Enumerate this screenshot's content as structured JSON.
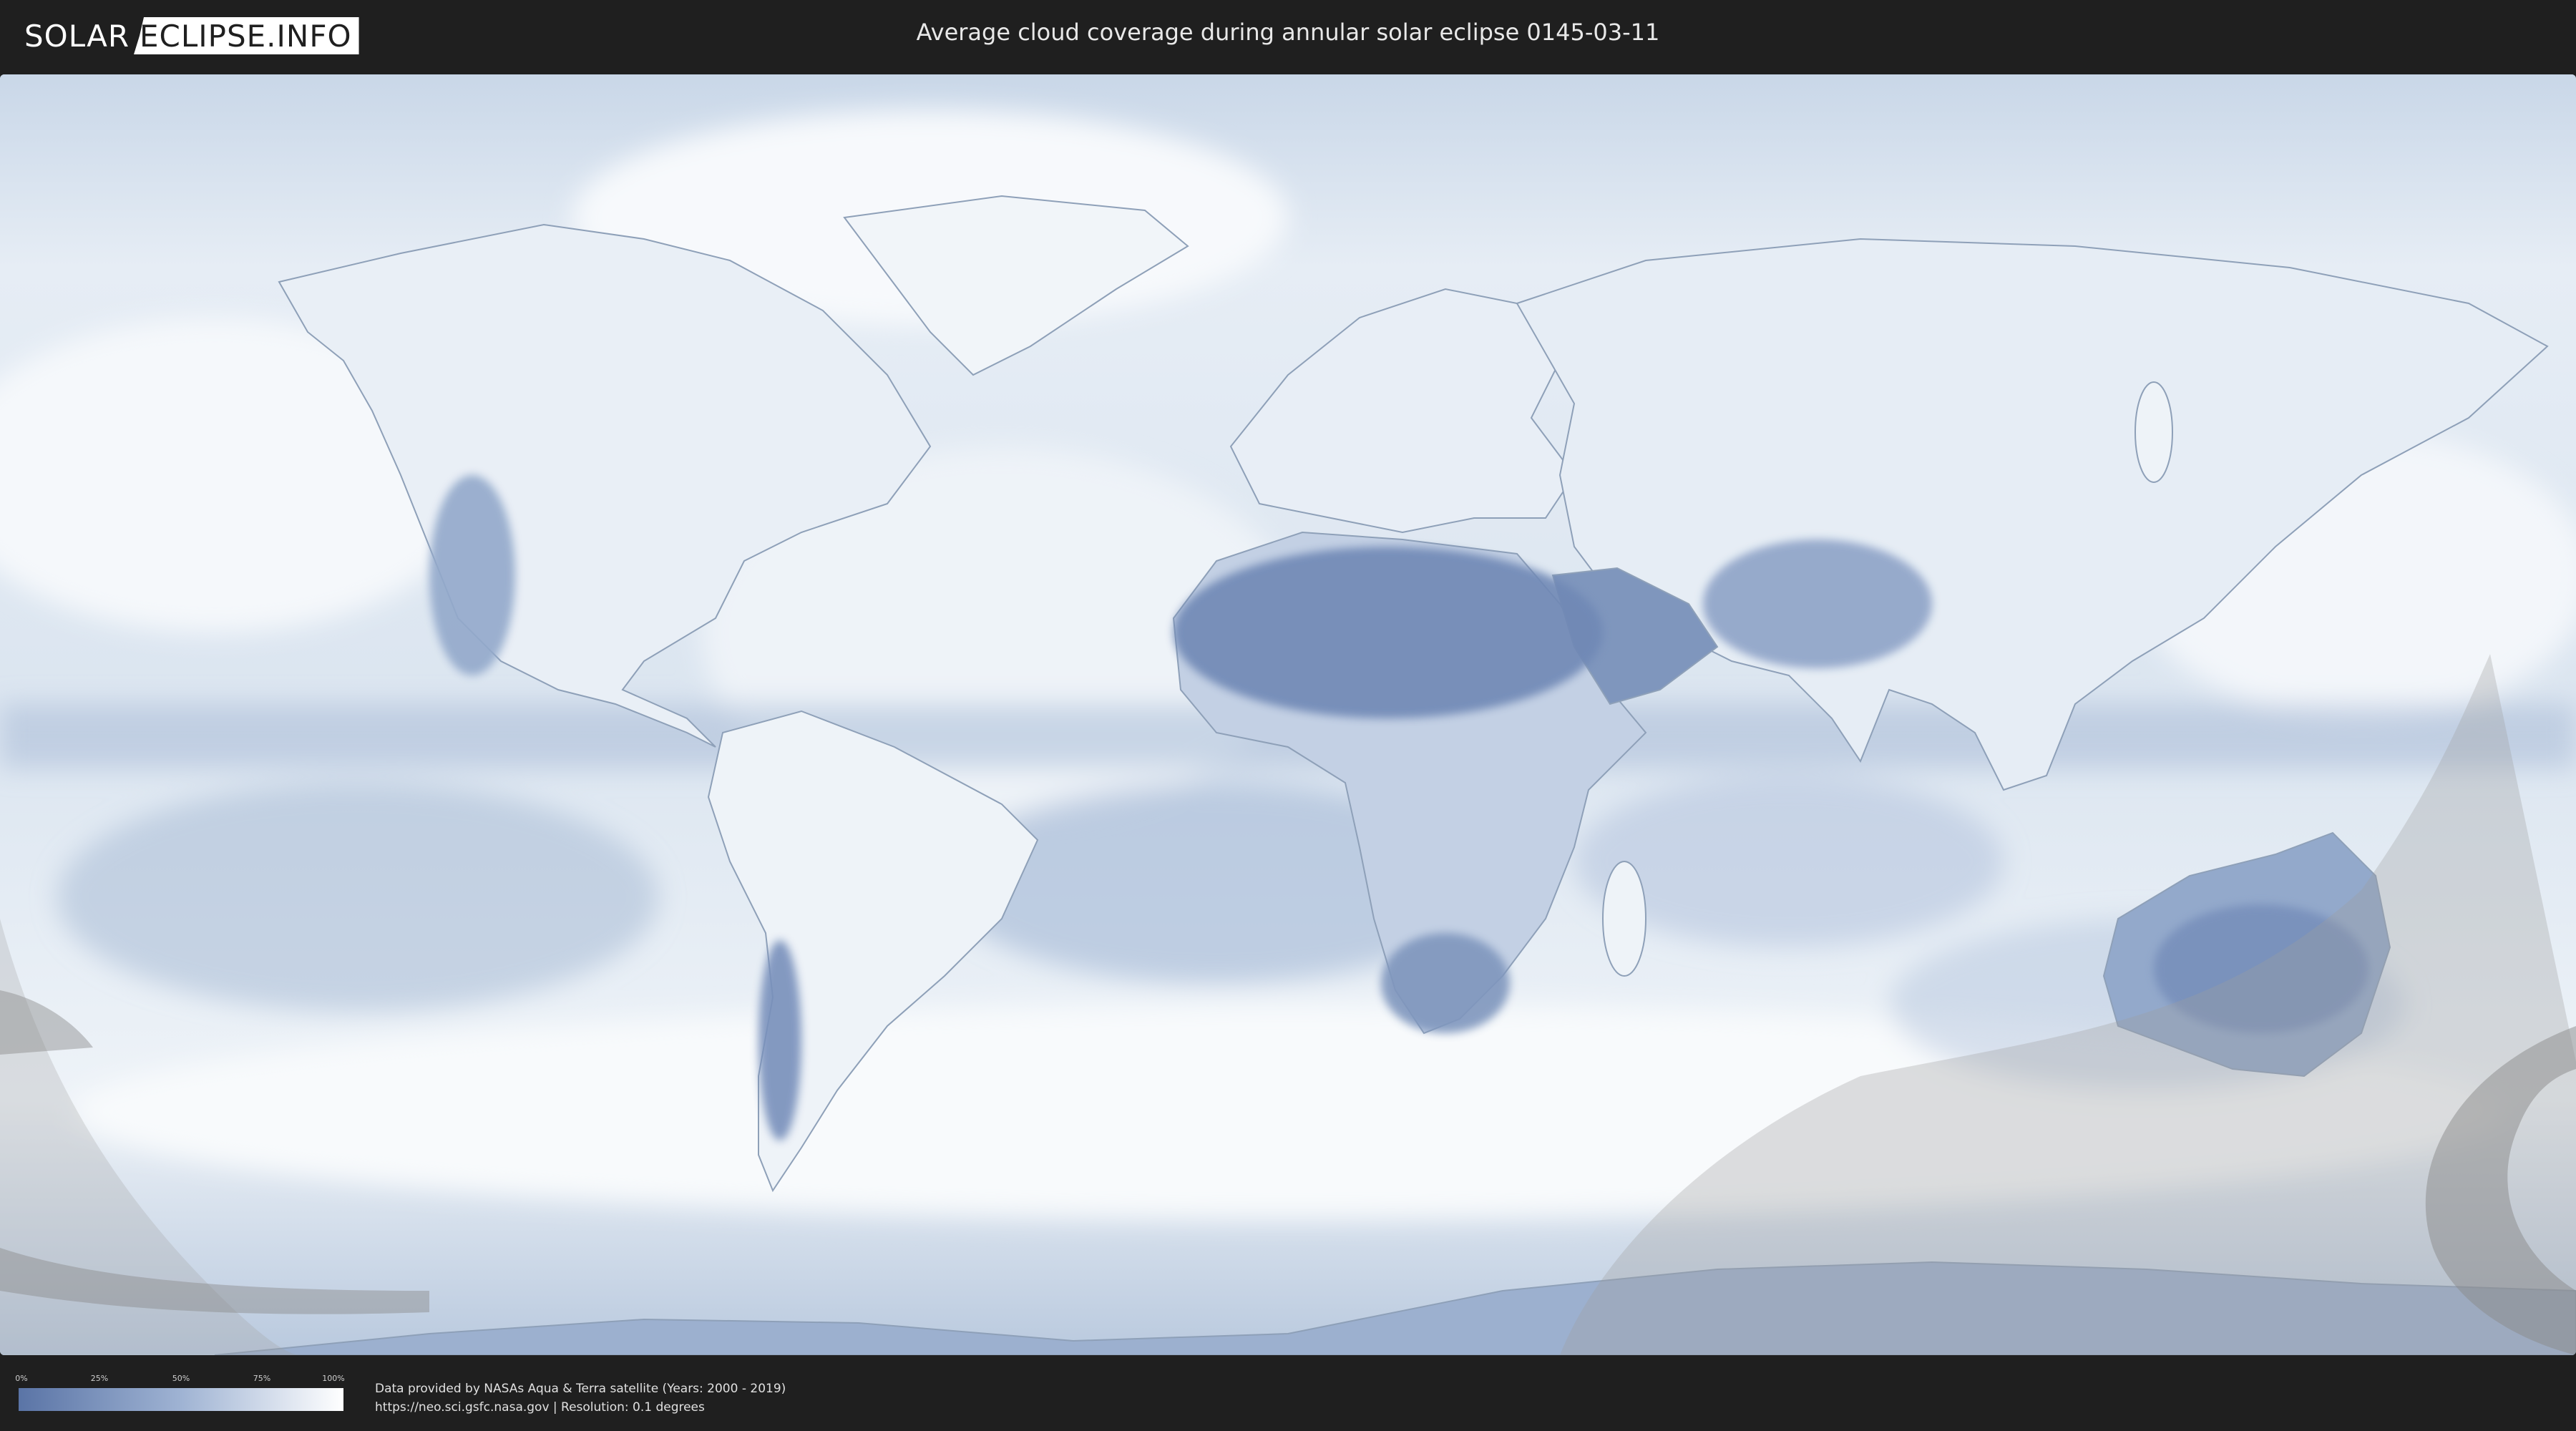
{
  "header": {
    "logo_prefix": "SOLAR",
    "logo_suffix": "ECLIPSE.INFO",
    "title": "Average cloud coverage during annular solar eclipse 0145-03-11"
  },
  "map": {
    "ocean_color": "#d8e3ef",
    "cloudy_color": "#ffffff",
    "clear_color": "#5f7fb0",
    "shadow_color": "#9a9a9a"
  },
  "legend": {
    "ticks": [
      "0%",
      "25%",
      "50%",
      "75%",
      "100%"
    ],
    "color_low": "#5a74a6",
    "color_high": "#ffffff"
  },
  "footer": {
    "credit_line1": "Data provided by NASAs Aqua & Terra satellite (Years: 2000 - 2019)",
    "credit_line2": "https://neo.sci.gsfc.nasa.gov | Resolution: 0.1 degrees"
  }
}
